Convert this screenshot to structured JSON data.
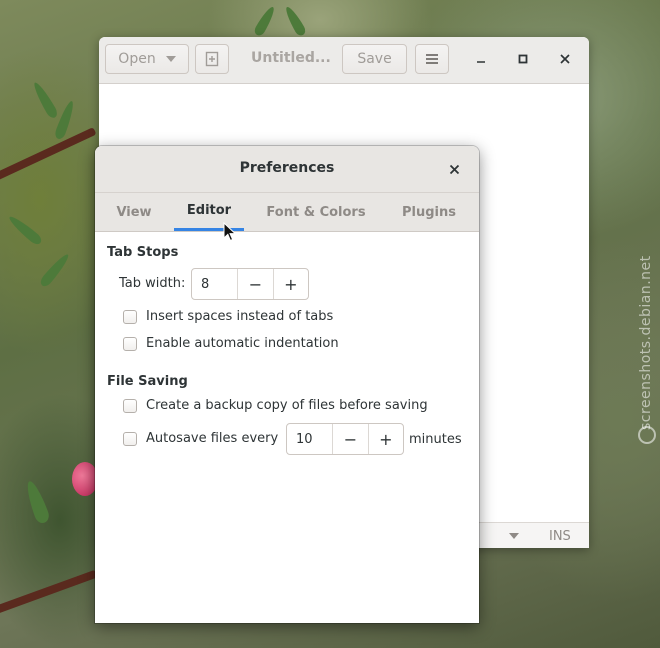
{
  "editor": {
    "open_label": "Open",
    "title": "Untitled...",
    "save_label": "Save",
    "status_mode": "INS"
  },
  "dialog": {
    "title": "Preferences",
    "tabs": [
      {
        "label": "View",
        "active": false
      },
      {
        "label": "Editor",
        "active": true
      },
      {
        "label": "Font & Colors",
        "active": false
      },
      {
        "label": "Plugins",
        "active": false
      }
    ],
    "tab_stops": {
      "section_title": "Tab Stops",
      "tab_width_label": "Tab width:",
      "tab_width_value": "8",
      "insert_spaces_label": "Insert spaces instead of tabs",
      "insert_spaces_checked": false,
      "auto_indent_label": "Enable automatic indentation",
      "auto_indent_checked": false
    },
    "file_saving": {
      "section_title": "File Saving",
      "backup_label": "Create a backup copy of files before saving",
      "backup_checked": false,
      "autosave_label": "Autosave files every",
      "autosave_checked": false,
      "autosave_value": "10",
      "autosave_unit": "minutes"
    },
    "spin_minus": "−",
    "spin_plus": "+"
  },
  "watermark": "screenshots.debian.net",
  "colors": {
    "accent": "#3584e4",
    "text": "#2e3436",
    "inactive_tab": "#8e8a86",
    "headerbar": "#e8e6e3"
  }
}
